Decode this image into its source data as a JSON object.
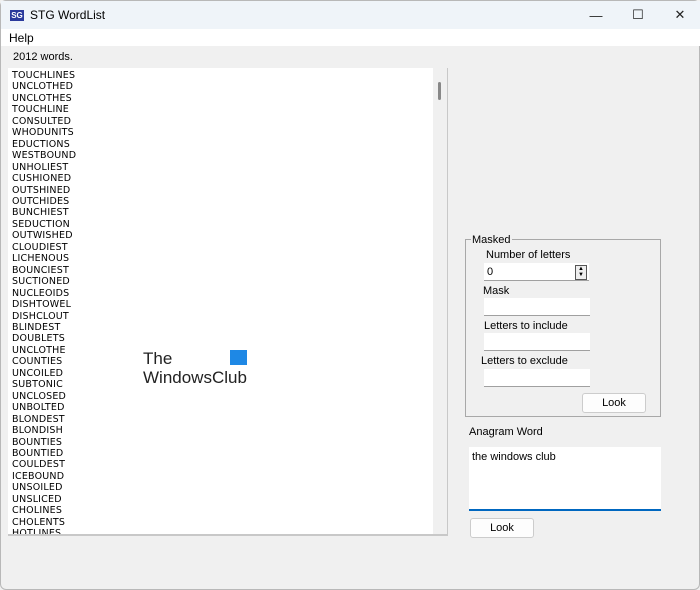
{
  "window": {
    "title": "STG WordList",
    "icon_text": "SG",
    "minimize": "—",
    "maximize": "☐",
    "close": "✕"
  },
  "menu": {
    "help": "Help"
  },
  "status": {
    "word_count": "2012 words."
  },
  "words": [
    "TOUCHLINES",
    "UNCLOTHED",
    "UNCLOTHES",
    "TOUCHLINE",
    "CONSULTED",
    "WHODUNITS",
    "EDUCTIONS",
    "WESTBOUND",
    "UNHOLIEST",
    "CUSHIONED",
    "OUTSHINED",
    "OUTCHIDES",
    "BUNCHIEST",
    "SEDUCTION",
    "OUTWISHED",
    "CLOUDIEST",
    "LICHENOUS",
    "BOUNCIEST",
    "SUCTIONED",
    "NUCLEOIDS",
    "DISHTOWEL",
    "DISHCLOUT",
    "BLINDEST",
    "DOUBLETS",
    "UNCLOTHE",
    "COUNTIES",
    "UNCOILED",
    "SUBTONIC",
    "UNCLOSED",
    "UNBOLTED",
    "BLONDEST",
    "BLONDISH",
    "BOUNTIES",
    "BOUNTIED",
    "COULDEST",
    "ICEBOUND",
    "UNSOILED",
    "UNSLICED",
    "CHOLINES",
    "CHOLENTS",
    "HOTLINES"
  ],
  "watermark": {
    "line1": "The",
    "line2": "WindowsClub"
  },
  "masked": {
    "title": "Masked",
    "num_letters_label": "Number of letters",
    "num_letters_value": "0",
    "mask_label": "Mask",
    "mask_value": "",
    "include_label": "Letters to include",
    "include_value": "",
    "exclude_label": "Letters to exclude",
    "exclude_value": "",
    "look": "Look"
  },
  "anagram": {
    "label": "Anagram Word",
    "value": "the windows club",
    "look": "Look"
  }
}
